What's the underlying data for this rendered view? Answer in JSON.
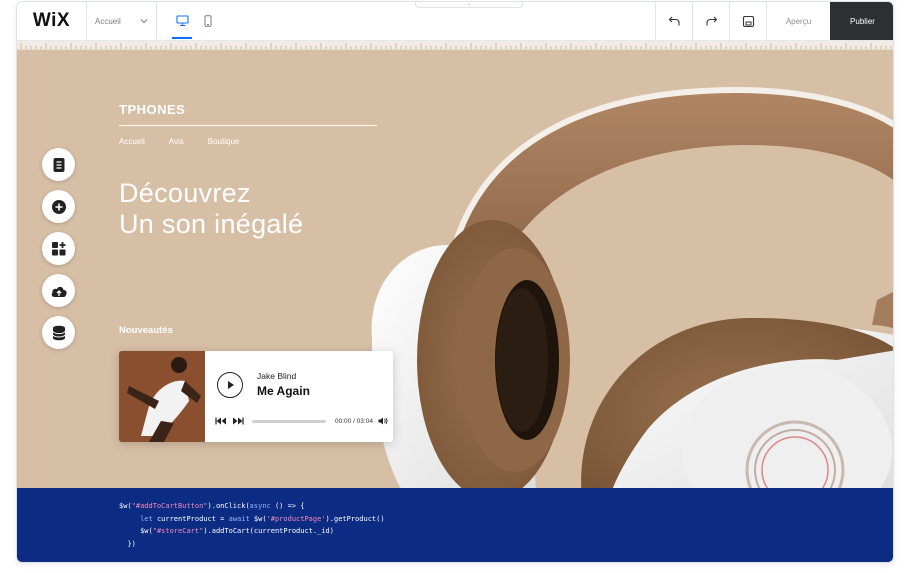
{
  "editor": {
    "logo": "WiX",
    "page_select": "Accueil",
    "preview_label": "Aperçu",
    "publish_label": "Publier"
  },
  "site": {
    "brand": "TPHONES",
    "nav": [
      "Accueil",
      "Avis",
      "Boutique"
    ],
    "hero_line1": "Découvrez",
    "hero_line2": "Un son inégalé",
    "new_label": "Nouveautés"
  },
  "player": {
    "artist": "Jake Blind",
    "track": "Me Again",
    "time": "00:00 / 03:04",
    "progress": 0
  },
  "code": {
    "line1_a": "$w(",
    "line1_str": "\"#addToCartButton\"",
    "line1_b": ").onClick(",
    "line1_kw": "async",
    "line1_c": " () => {",
    "line2_kw": "let",
    "line2_a": " currentProduct = ",
    "line2_kw2": "await",
    "line2_b": " $w(",
    "line2_str": "'#productPage'",
    "line2_c": ").getProduct()",
    "line3_a": "$w(",
    "line3_str": "\"#storeCart\"",
    "line3_b": ").addToCart(currentProduct._id)",
    "line4": "})"
  },
  "colors": {
    "canvas": "#d7bfa6",
    "code_bg": "#0c2b82",
    "publish_bg": "#2d2f31",
    "accent": "#116dff"
  }
}
